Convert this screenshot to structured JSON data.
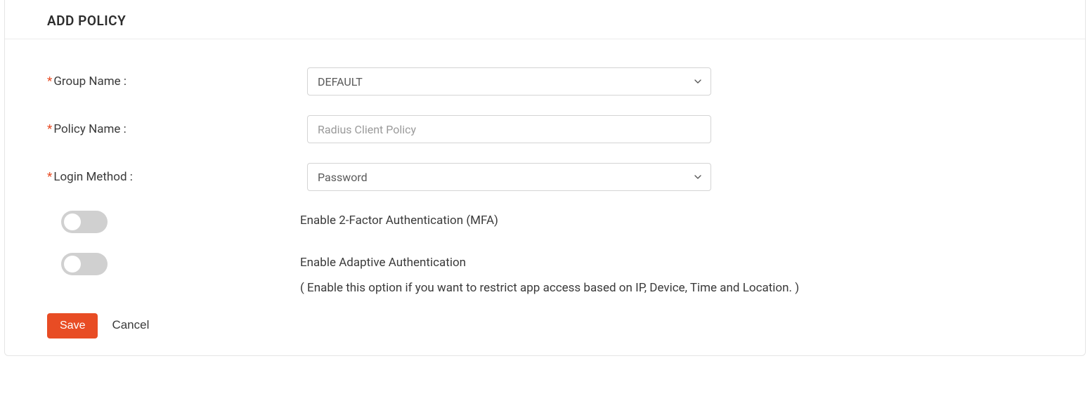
{
  "header": {
    "title": "ADD POLICY"
  },
  "fields": {
    "group_name": {
      "label": "Group Name :",
      "required": "*",
      "value": "DEFAULT"
    },
    "policy_name": {
      "label": "Policy Name :",
      "required": "*",
      "placeholder": "Radius Client Policy",
      "value": ""
    },
    "login_method": {
      "label": "Login Method :",
      "required": "*",
      "value": "Password"
    },
    "mfa": {
      "label": "Enable 2-Factor Authentication (MFA)"
    },
    "adaptive": {
      "label": "Enable Adaptive Authentication",
      "hint": "( Enable this option if you want to restrict app access based on IP, Device, Time and Location. )"
    }
  },
  "actions": {
    "save": "Save",
    "cancel": "Cancel"
  }
}
